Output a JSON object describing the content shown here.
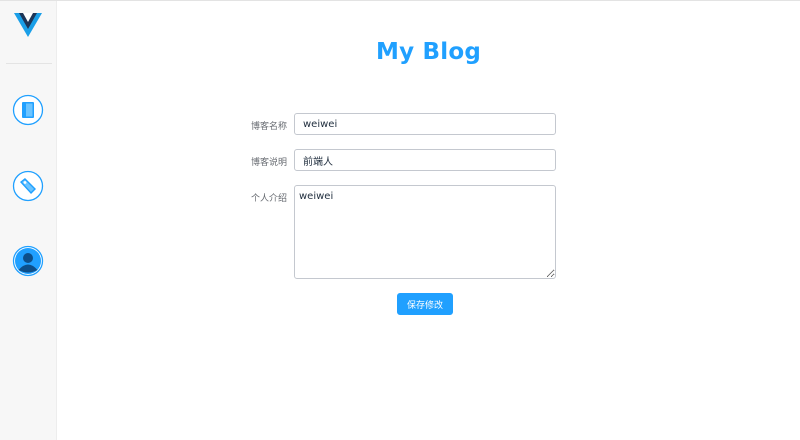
{
  "app": {
    "title": "My Blog",
    "accent_color": "#20a0ff"
  },
  "sidebar": {
    "logo_icon": "vue-logo-icon",
    "items": [
      {
        "icon": "book-icon"
      },
      {
        "icon": "tag-icon"
      },
      {
        "icon": "user-icon"
      }
    ]
  },
  "form": {
    "blog_name": {
      "label": "博客名称",
      "value": "weiwei"
    },
    "blog_description": {
      "label": "博客说明",
      "value": "前端人"
    },
    "introduction": {
      "label": "个人介绍",
      "value": "weiwei"
    },
    "save_label": "保存修改"
  }
}
